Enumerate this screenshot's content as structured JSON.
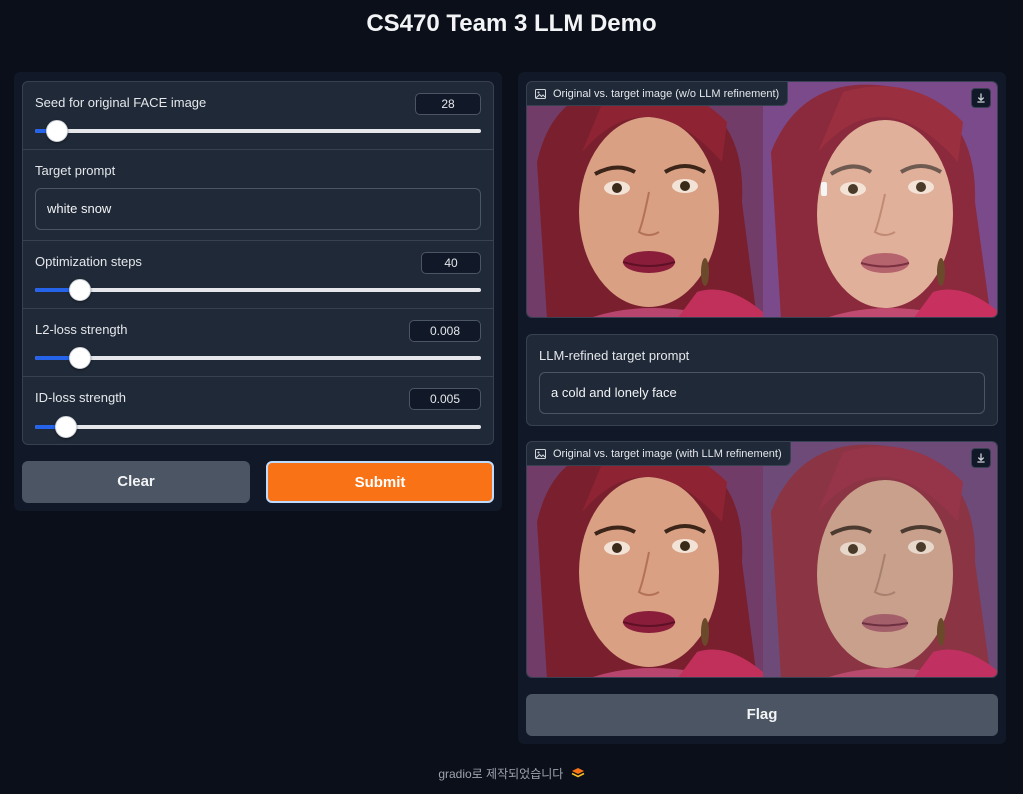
{
  "app": {
    "title": "CS470 Team 3 LLM Demo"
  },
  "controls": {
    "seed": {
      "label": "Seed for original FACE image",
      "value": "28",
      "fraction": 0.05
    },
    "target_prompt": {
      "label": "Target prompt",
      "value": "white snow"
    },
    "optimization_steps": {
      "label": "Optimization steps",
      "value": "40",
      "fraction": 0.1
    },
    "l2_loss": {
      "label": "L2-loss strength",
      "value": "0.008",
      "fraction": 0.1
    },
    "id_loss": {
      "label": "ID-loss strength",
      "value": "0.005",
      "fraction": 0.07
    }
  },
  "buttons": {
    "clear": "Clear",
    "submit": "Submit",
    "flag": "Flag"
  },
  "outputs": {
    "image_wo_llm": {
      "label": "Original vs. target image (w/o LLM refinement)"
    },
    "refined_prompt": {
      "label": "LLM-refined target prompt",
      "value": "a cold and lonely face"
    },
    "image_with_llm": {
      "label": "Original vs. target image (with LLM refinement)"
    }
  },
  "footer": {
    "text": "gradio로 제작되었습니다"
  },
  "colors": {
    "accent": "#f97316",
    "slider": "#2563eb",
    "background": "#0b0f19",
    "panel": "#111827"
  }
}
